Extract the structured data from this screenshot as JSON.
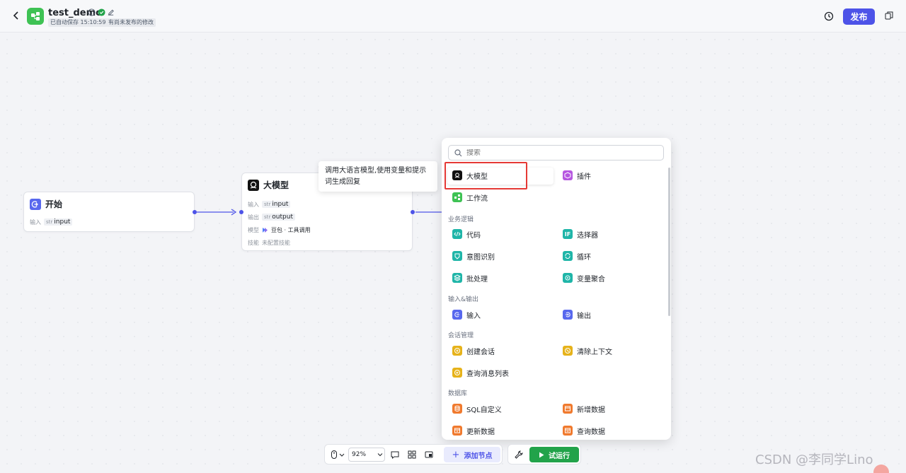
{
  "header": {
    "title": "test_demo",
    "autosave": "已自动保存 15:10:59",
    "unpublished": "有尚未发布的修改",
    "publish_label": "发布"
  },
  "nodes": {
    "start": {
      "title": "开始",
      "input_label": "输入",
      "input_type": "str",
      "input_name": "input"
    },
    "llm": {
      "title": "大模型",
      "input_label": "输入",
      "input_type": "str",
      "input_name": "input",
      "output_label": "输出",
      "output_type": "str",
      "output_name": "output",
      "model_label": "模型",
      "model_value": "豆包 · 工具调用",
      "skill_label": "技能",
      "skill_value": "未配置技能"
    }
  },
  "tooltip": "调用大语言模型,使用变量和提示词生成回复",
  "panel": {
    "search_placeholder": "搜索",
    "items_top": [
      {
        "label": "大模型",
        "color": "#111111"
      },
      {
        "label": "插件",
        "color": "#b657e0"
      },
      {
        "label": "工作流",
        "color": "#3ec254"
      }
    ],
    "section_logic": "业务逻辑",
    "logic": [
      {
        "label": "代码",
        "color": "#1fb5a8"
      },
      {
        "label": "选择器",
        "color": "#1fb5a8"
      },
      {
        "label": "意图识别",
        "color": "#1fb5a8"
      },
      {
        "label": "循环",
        "color": "#1fb5a8"
      },
      {
        "label": "批处理",
        "color": "#1fb5a8"
      },
      {
        "label": "变量聚合",
        "color": "#1fb5a8"
      }
    ],
    "section_io": "输入&输出",
    "io": [
      {
        "label": "输入",
        "color": "#5868ee"
      },
      {
        "label": "输出",
        "color": "#5868ee"
      }
    ],
    "section_conv": "会话管理",
    "conv": [
      {
        "label": "创建会话",
        "color": "#e6b21a"
      },
      {
        "label": "清除上下文",
        "color": "#e6b21a"
      },
      {
        "label": "查询消息列表",
        "color": "#e6b21a"
      }
    ],
    "section_db": "数据库",
    "db": [
      {
        "label": "SQL自定义",
        "color": "#f07a2e"
      },
      {
        "label": "新增数据",
        "color": "#f07a2e"
      },
      {
        "label": "更新数据",
        "color": "#f07a2e"
      },
      {
        "label": "查询数据",
        "color": "#f07a2e"
      }
    ]
  },
  "toolbar": {
    "zoom": "92%",
    "add_node_label": "添加节点",
    "run_label": "试运行"
  },
  "watermark": "CSDN @李同学Lino"
}
